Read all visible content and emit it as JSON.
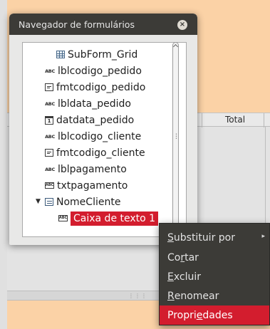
{
  "window": {
    "title": "Navegador de formulários",
    "close_glyph": "×"
  },
  "table": {
    "column_total": "Total"
  },
  "tree": {
    "items": [
      {
        "label": "SubForm_Grid",
        "icon": "table-grid-icon"
      },
      {
        "label": "lblcodigo_pedido",
        "icon": "label-abc-icon"
      },
      {
        "label": "fmtcodigo_pedido",
        "icon": "formatted-field-icon"
      },
      {
        "label": "lbldata_pedido",
        "icon": "label-abc-icon"
      },
      {
        "label": "datdata_pedido",
        "icon": "date-field-icon"
      },
      {
        "label": "lblcodigo_cliente",
        "icon": "label-abc-icon"
      },
      {
        "label": "fmtcodigo_cliente",
        "icon": "formatted-field-icon"
      },
      {
        "label": "lblpagamento",
        "icon": "label-abc-icon"
      },
      {
        "label": "txtpagamento",
        "icon": "text-field-icon"
      },
      {
        "label": "NomeCliente",
        "icon": "form-icon",
        "expanded": true
      },
      {
        "label": "Caixa de texto 1",
        "icon": "text-field-icon",
        "selected": true
      }
    ],
    "abc_glyph": "ABC",
    "date_glyph": "1",
    "text_glyph": "ABC"
  },
  "context_menu": {
    "items": [
      {
        "pre": "",
        "mnemonic": "S",
        "post": "ubstituir por",
        "has_submenu": true
      },
      {
        "pre": "Co",
        "mnemonic": "r",
        "post": "tar"
      },
      {
        "pre": "",
        "mnemonic": "E",
        "post": "xcluir"
      },
      {
        "pre": "",
        "mnemonic": "R",
        "post": "enomear"
      },
      {
        "pre": "Propri",
        "mnemonic": "e",
        "post": "dades",
        "active": true
      }
    ],
    "submenu_glyph": "▸"
  },
  "colors": {
    "titlebar": "#3c3b37",
    "selection": "#d31d2e",
    "page_orange": "#fbd2a6"
  }
}
